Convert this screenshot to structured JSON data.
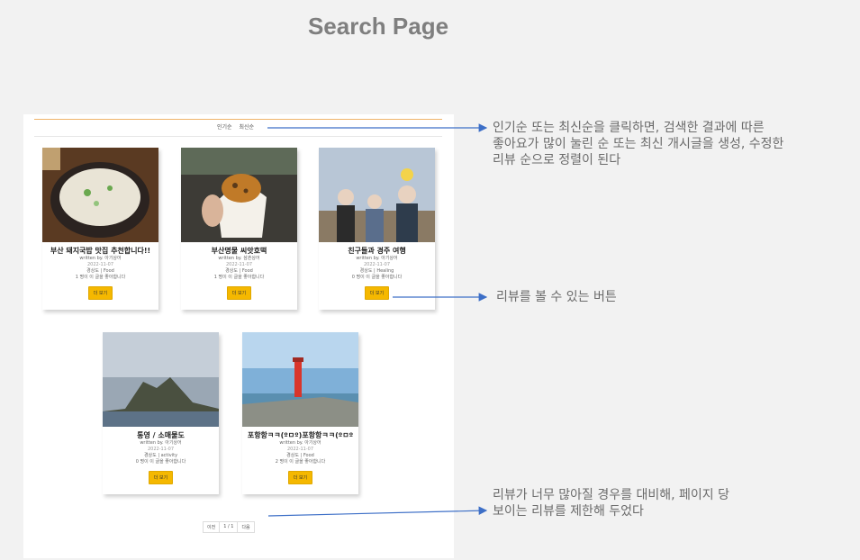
{
  "slide": {
    "title": "Search Page"
  },
  "sort": {
    "options": [
      "인기순",
      "최신순"
    ]
  },
  "cards": [
    {
      "title": "부산 돼지국밥 맛집 추천합니다!!",
      "author": "written by. 아기상어",
      "date": "2022-11-07",
      "meta": "경상도 | Food",
      "likes": "1 명이 이 글을 좋아합니다",
      "button": "더 보기",
      "image": "pork-soup-photo"
    },
    {
      "title": "부산명물 씨앗호떡",
      "author": "written by. 삼촌상어",
      "date": "2022-11-07",
      "meta": "경상도 | Food",
      "likes": "1 명이 이 글을 좋아합니다",
      "button": "더 보기",
      "image": "hotteok-photo"
    },
    {
      "title": "친구들과 경주 여행",
      "author": "written by. 아기상어",
      "date": "2022-11-07",
      "meta": "경상도 | Healing",
      "likes": "0 명이 이 글을 좋아합니다",
      "button": "더 보기",
      "image": "friends-photo"
    },
    {
      "title": "통영 / 소매물도",
      "author": "written by. 아기상어",
      "date": "2022-11-07",
      "meta": "경상도 | activity",
      "likes": "0 명이 이 글을 좋아합니다",
      "button": "더 보기",
      "image": "island-photo"
    },
    {
      "title": "포항항ㅋㅋ(ºㅁº)포항항ㅋㅋ(ºㅁº",
      "author": "written by. 아기상어",
      "date": "2022-11-07",
      "meta": "경상도 | Food",
      "likes": "2 명이 이 글을 좋아합니다",
      "button": "더 보기",
      "image": "lighthouse-photo"
    }
  ],
  "pagination": {
    "prev": "이전",
    "current": "1 / 1",
    "next": "다음"
  },
  "annotations": {
    "sort_note_1": "인기순 또는 최신순을 클릭하면, 검색한 결과에 따른",
    "sort_note_2": "좋아요가 많이 눌린 순 또는 최신 개시글을 생성, 수정한",
    "sort_note_3": "리뷰 순으로 정렬이 된다",
    "button_note": "리뷰를 볼 수 있는 버튼",
    "page_note_1": "리뷰가 너무 많아질 경우를 대비해, 페이지 당",
    "page_note_2": "보이는 리뷰를 제한해 두었다"
  },
  "colors": {
    "accent": "#f5b800",
    "arrow": "#3d6fc7",
    "sort_line": "#f0b36a"
  }
}
